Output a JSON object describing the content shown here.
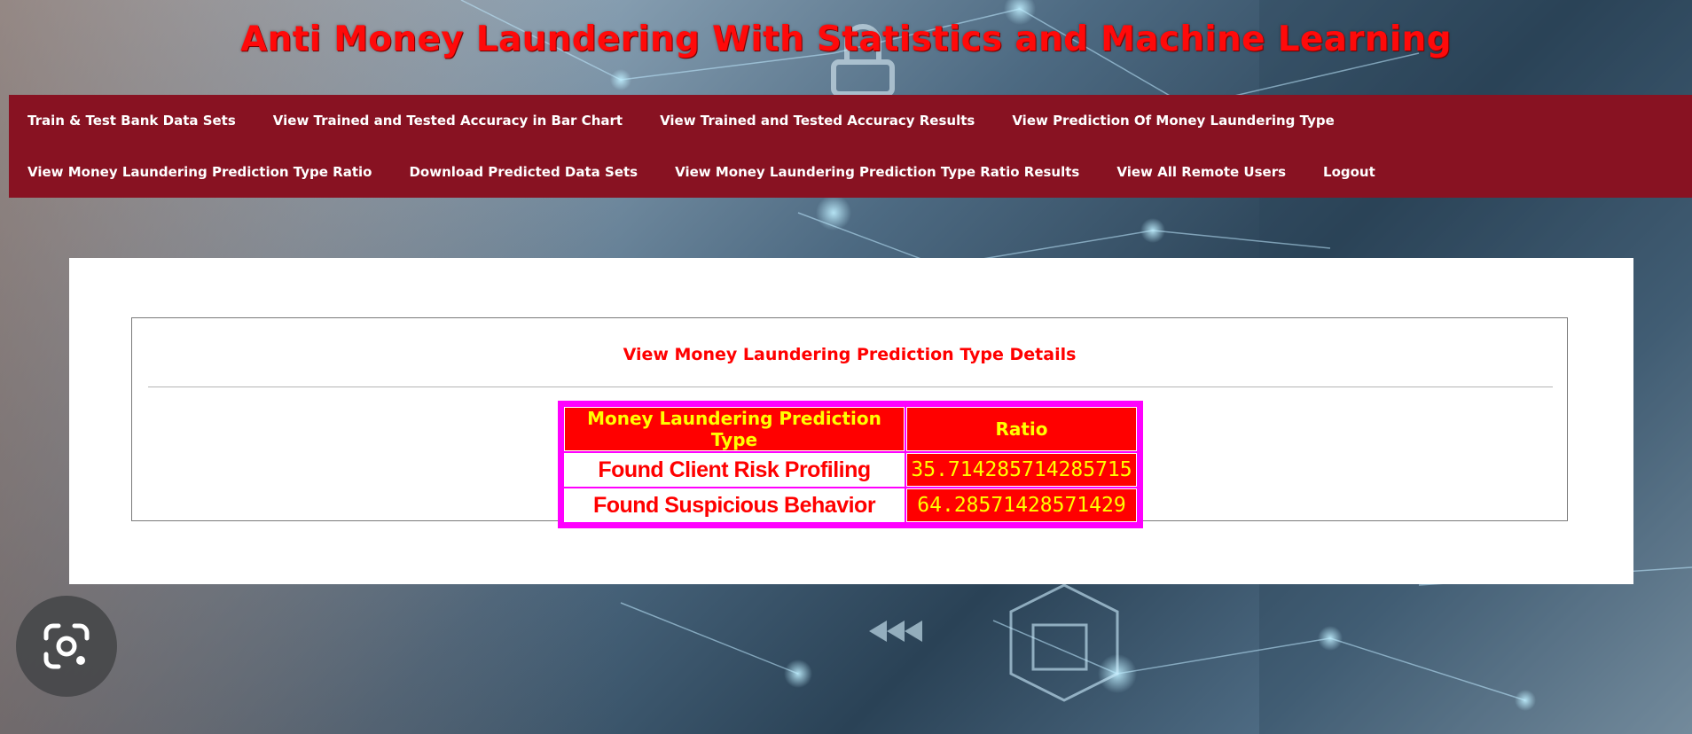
{
  "header": {
    "title": "Anti Money Laundering With Statistics and Machine Learning"
  },
  "nav": {
    "row1": [
      "Train & Test Bank Data Sets",
      "View Trained and Tested Accuracy in Bar Chart",
      "View Trained and Tested Accuracy Results",
      "View Prediction Of Money Laundering Type"
    ],
    "row2": [
      "View Money Laundering Prediction Type Ratio",
      "Download Predicted Data Sets",
      "View Money Laundering Prediction Type Ratio Results",
      "View All Remote Users",
      "Logout"
    ]
  },
  "main": {
    "heading": "View Money Laundering Prediction Type Details",
    "table": {
      "columns": [
        "Money Laundering Prediction Type",
        "Ratio"
      ],
      "rows": [
        {
          "type": "Found Client Risk Profiling",
          "ratio": "35.714285714285715"
        },
        {
          "type": "Found Suspicious Behavior",
          "ratio": "64.28571428571429"
        }
      ]
    }
  },
  "overlay": {
    "icon": "camera-lens-icon"
  },
  "colors": {
    "title": "#ff0a0a",
    "nav_background": "#881222",
    "table_border": "#ff00ff",
    "table_header_bg": "#ff0000",
    "table_header_text": "#ffff00"
  }
}
